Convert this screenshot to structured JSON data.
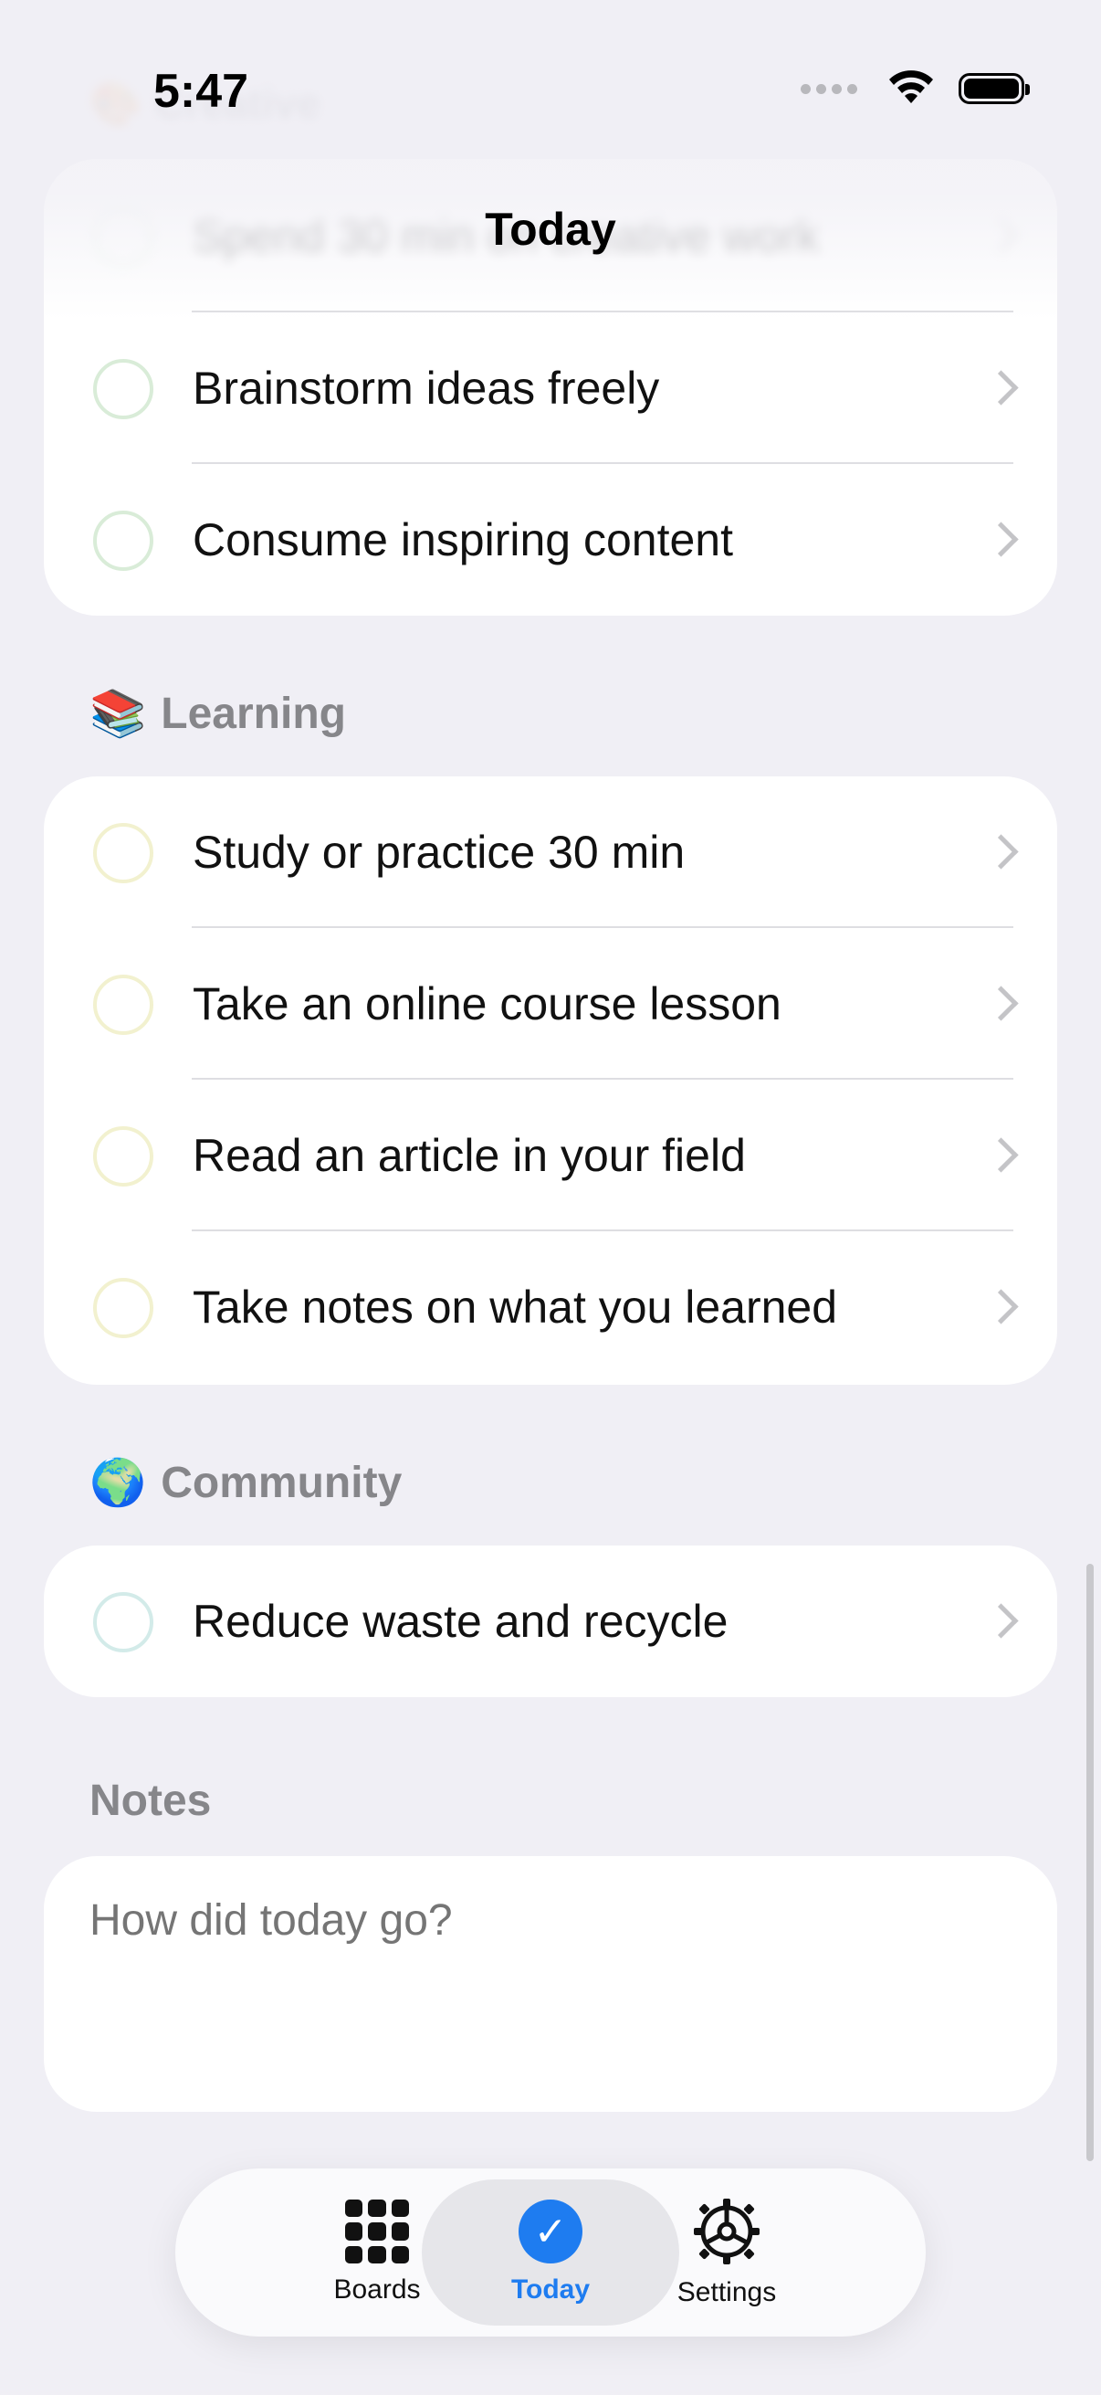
{
  "status_bar": {
    "time": "5:47"
  },
  "nav": {
    "title": "Today"
  },
  "faded_section": {
    "emoji": "🎨",
    "title": "Creative",
    "first_item": "Spend 30 min on creative work"
  },
  "creative_items": [
    {
      "label": "Brainstorm ideas freely"
    },
    {
      "label": "Consume inspiring content"
    }
  ],
  "learning": {
    "emoji": "📚",
    "title": "Learning",
    "items": [
      {
        "label": "Study or practice 30 min"
      },
      {
        "label": "Take an online course lesson"
      },
      {
        "label": "Read an article in your field"
      },
      {
        "label": "Take notes on what you learned"
      }
    ]
  },
  "community": {
    "emoji": "🌍",
    "title": "Community",
    "items": [
      {
        "label": "Reduce waste and recycle"
      }
    ]
  },
  "notes": {
    "title": "Notes",
    "placeholder": "How did today go?"
  },
  "tabbar": {
    "boards": "Boards",
    "today": "Today",
    "settings": "Settings",
    "active": "today",
    "accent": "#1E7CF0"
  }
}
